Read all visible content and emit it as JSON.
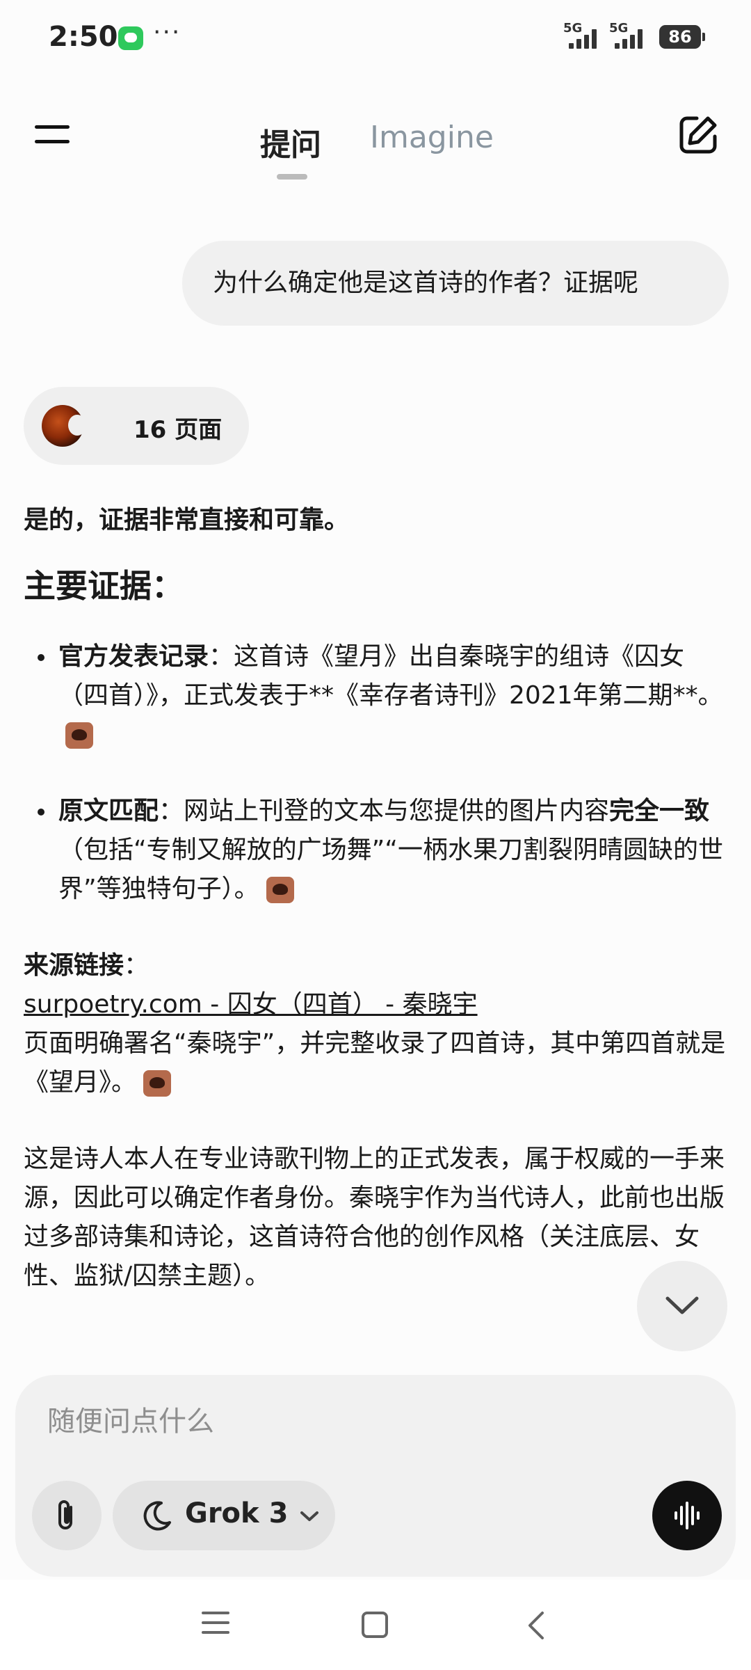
{
  "status_bar": {
    "time": "2:50",
    "dots": "···",
    "network_1": "5G",
    "network_2": "5G",
    "battery": "86"
  },
  "header": {
    "tab_active": "提问",
    "tab_other": "Imagine"
  },
  "user_message": "为什么确定他是这首诗的作者？证据呢",
  "sources_chip": {
    "label": "16 页面"
  },
  "answer": {
    "lead": "是的，证据非常直接和可靠。",
    "heading": "主要证据：",
    "bullets": [
      {
        "bold": "官方发表记录",
        "text": "：这首诗《望月》出自秦晓宇的组诗《囚女（四首）》，正式发表于**《幸存者诗刊》2021年第二期**。"
      },
      {
        "bold": "原文匹配",
        "text": "：网站上刊登的文本与您提供的图片内容",
        "bold2": "完全一致",
        "text2": "（包括“专制又解放的广场舞”“一柄水果刀割裂阴晴圆缺的世界”等独特句子）。"
      }
    ],
    "source_heading": "来源链接",
    "source_colon": "：",
    "source_link": "surpoetry.com - 囚女（四首） - 秦晓宇",
    "source_desc": "页面明确署名“秦晓宇”，并完整收录了四首诗，其中第四首就是《望月》。",
    "conclusion": "这是诗人本人在专业诗歌刊物上的正式发表，属于权威的一手来源，因此可以确定作者身份。秦晓宇作为当代诗人，此前也出版过多部诗集和诗论，这首诗符合他的创作风格（关注底层、女性、监狱/囚禁主题）。"
  },
  "input": {
    "placeholder": "随便问点什么",
    "model": "Grok 3"
  },
  "icons": {
    "menu": "hamburger-icon",
    "compose": "edit-icon",
    "scroll": "chevron-down-icon",
    "attach": "paperclip-icon",
    "model": "moon-icon",
    "voice": "waveform-icon"
  },
  "colors": {
    "accent_green": "#2ec95c",
    "voice_button": "#111111",
    "inactive_tab": "#8a96a0"
  }
}
